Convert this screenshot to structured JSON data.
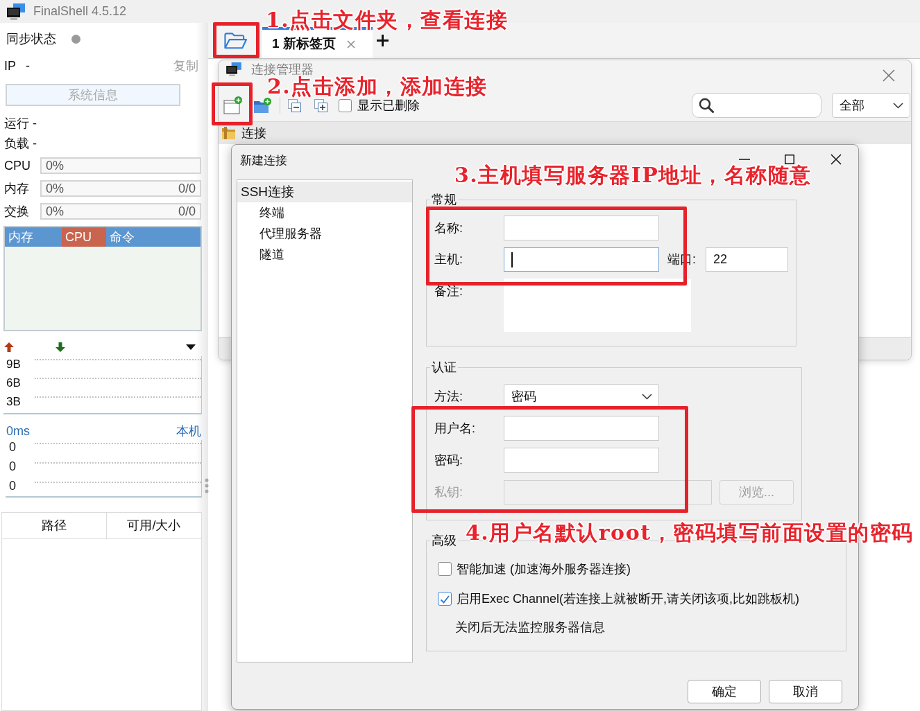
{
  "app": {
    "title": "FinalShell 4.5.12"
  },
  "sidebar": {
    "sync": {
      "label": "同步状态"
    },
    "ip": {
      "label": "IP",
      "value": "-",
      "action": "复制"
    },
    "system_info_button": {
      "label": "系统信息",
      "disabled": true
    },
    "stats": [
      "运行 -",
      "负载 -"
    ],
    "meters": [
      {
        "label": "CPU",
        "reading": "0%"
      },
      {
        "label": "内存",
        "reading": "0%",
        "amount": "0/0"
      },
      {
        "label": "交换",
        "reading": "0%",
        "amount": "0/0"
      }
    ],
    "process_tabs": [
      {
        "label": "内存",
        "selected": false
      },
      {
        "label": "CPU",
        "selected": true
      },
      {
        "label": "命令",
        "selected": false
      }
    ],
    "network": {
      "ticks": [
        "9B",
        "6B",
        "3B"
      ]
    },
    "latency": {
      "reading": "0ms",
      "host": "本机",
      "ticks": [
        "0",
        "0",
        "0"
      ]
    },
    "disk_table": {
      "columns": [
        "路径",
        "可用/大小"
      ]
    }
  },
  "tabs": [
    {
      "label": "1 新标签页",
      "selected": true
    }
  ],
  "connection_manager": {
    "title": "连接管理器",
    "show_deleted": {
      "label": "显示已删除",
      "checked": false
    },
    "filter": "全部",
    "tree": [
      {
        "label": "连接"
      }
    ]
  },
  "new_connection_dialog": {
    "title": "新建连接",
    "nav": [
      {
        "label": "SSH连接",
        "selected": true,
        "children": [
          {
            "label": "终端",
            "selected": false
          },
          {
            "label": "代理服务器",
            "selected": false
          },
          {
            "label": "隧道",
            "selected": false
          }
        ]
      }
    ],
    "general": {
      "legend": "常规",
      "name": {
        "label": "名称:"
      },
      "host": {
        "label": "主机:",
        "focused": true
      },
      "port": {
        "label": "端口:",
        "value": "22"
      },
      "remark": {
        "label": "备注:"
      }
    },
    "auth": {
      "legend": "认证",
      "method": {
        "label": "方法:",
        "value": "密码"
      },
      "username": {
        "label": "用户名:"
      },
      "password": {
        "label": "密码:"
      },
      "private_key": {
        "label": "私钥:",
        "disabled": true
      },
      "browse_button": {
        "label": "浏览...",
        "disabled": true
      }
    },
    "advanced": {
      "legend": "高级",
      "options": [
        {
          "label": "智能加速 (加速海外服务器连接)",
          "checked": false
        },
        {
          "label": "启用Exec Channel(若连接上就被断开,请关闭该项,比如跳板机)",
          "checked": true
        }
      ],
      "note": "关闭后无法监控服务器信息"
    },
    "buttons": [
      {
        "label": "确定"
      },
      {
        "label": "取消"
      }
    ]
  },
  "annotations": [
    {
      "text": "1.点击文件夹，查看连接"
    },
    {
      "text": "2.点击添加，添加连接"
    },
    {
      "text": "3.主机填写服务器IP地址，名称随意"
    },
    {
      "text": "4.用户名默认root，密码填写前面设置的密码"
    }
  ]
}
